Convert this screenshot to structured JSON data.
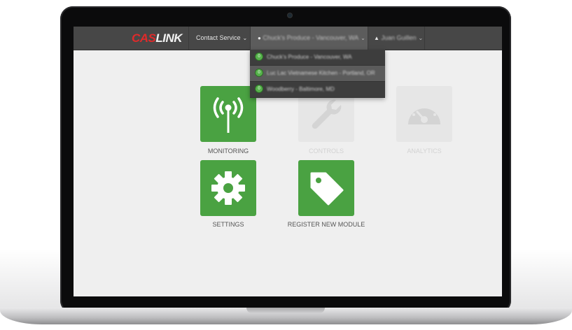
{
  "brand": {
    "cas": "CAS",
    "link": "LINK"
  },
  "nav": {
    "contact_label": "Contact Service",
    "location_label": "Chuck's Produce - Vancouver, WA",
    "user_label": "Juan Guillen"
  },
  "locations": [
    {
      "badge": "0",
      "label": "Chuck's Produce - Vancouver, WA"
    },
    {
      "badge": "0",
      "label": "Luc Lac Vietnamese Kitchen - Portland, OR"
    },
    {
      "badge": "0",
      "label": "Woodberry - Baltimore, MD"
    }
  ],
  "modules": [
    {
      "label": "MONITORING",
      "icon": "antenna-signal-icon",
      "enabled": true
    },
    {
      "label": "CONTROLS",
      "icon": "wrench-icon",
      "enabled": false
    },
    {
      "label": "ANALYTICS",
      "icon": "gauge-icon",
      "enabled": false
    },
    {
      "label": "SETTINGS",
      "icon": "gear-icon",
      "enabled": true
    },
    {
      "label": "REGISTER NEW MODULE",
      "icon": "tag-icon",
      "enabled": true
    }
  ],
  "colors": {
    "green": "#4aa242",
    "brand_red": "#e02a2a",
    "topbar": "#474747"
  }
}
